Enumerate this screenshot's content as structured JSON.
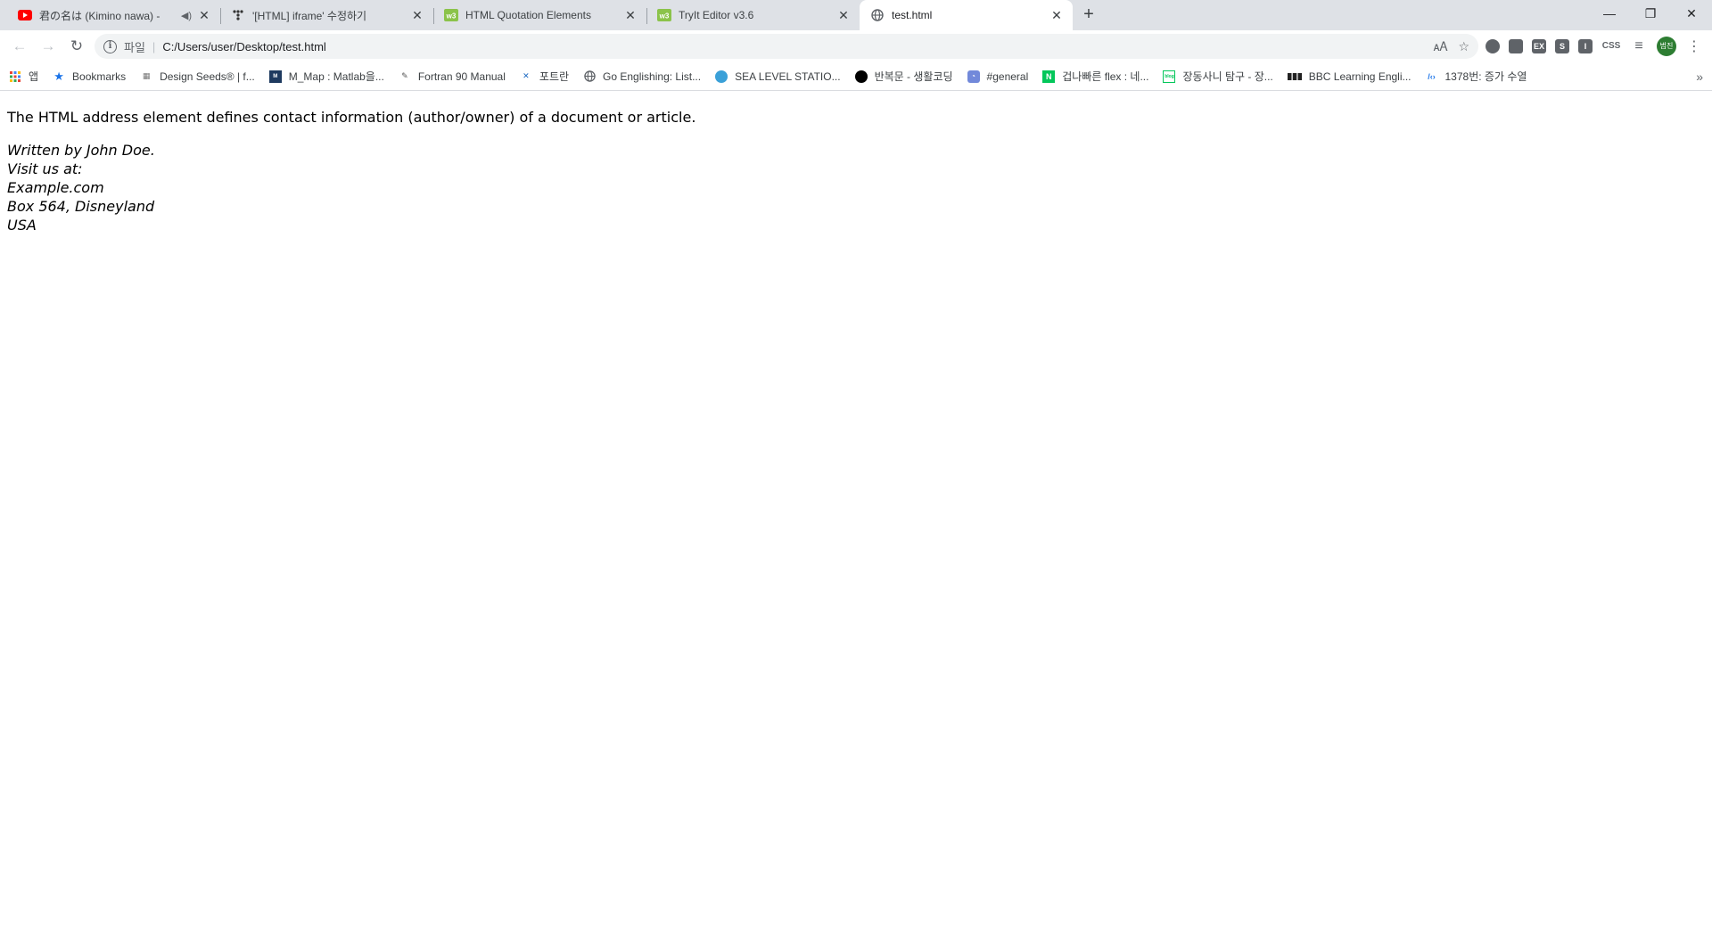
{
  "tabs": [
    {
      "title": "君の名は (Kimino nawa) - ",
      "favicon": "youtube-icon",
      "audio": true,
      "active": false
    },
    {
      "title": "'[HTML] iframe' 수정하기",
      "favicon": "velog-icon",
      "audio": false,
      "active": false
    },
    {
      "title": "HTML Quotation Elements",
      "favicon": "w3schools-icon",
      "audio": false,
      "active": false
    },
    {
      "title": "TryIt Editor v3.6",
      "favicon": "w3schools-icon",
      "audio": false,
      "active": false
    },
    {
      "title": "test.html",
      "favicon": "globe-icon",
      "audio": false,
      "active": true
    }
  ],
  "address_bar": {
    "scheme_label": "파일",
    "url": "C:/Users/user/Desktop/test.html"
  },
  "extensions": {
    "ext3": "EX",
    "ext4": "S",
    "ext5": "I",
    "ext6": "CSS"
  },
  "profile": {
    "initials": "범진"
  },
  "bookmarks": [
    {
      "label": "앱",
      "icon": "apps-grid-icon"
    },
    {
      "label": "Bookmarks",
      "icon": "star-icon"
    },
    {
      "label": "Design Seeds® | f...",
      "icon": "design-seeds-icon"
    },
    {
      "label": "M_Map : Matlab을...",
      "icon": "mmap-icon"
    },
    {
      "label": "Fortran 90 Manual",
      "icon": "fortran-icon"
    },
    {
      "label": "포트란",
      "icon": "dots-icon"
    },
    {
      "label": "Go Englishing: List...",
      "icon": "globe-icon"
    },
    {
      "label": "SEA LEVEL STATIO...",
      "icon": "sea-level-icon"
    },
    {
      "label": "반복문 - 생활코딩",
      "icon": "black-circle-icon"
    },
    {
      "label": "#general",
      "icon": "discord-icon"
    },
    {
      "label": "겁나빠른 flex : 네...",
      "icon": "naver-icon"
    },
    {
      "label": "장동사니 탐구 - 장...",
      "icon": "blog-icon"
    },
    {
      "label": "BBC Learning Engli...",
      "icon": "bbc-icon"
    },
    {
      "label": "1378번: 증가 수열",
      "icon": "code-icon"
    }
  ],
  "content": {
    "intro": "The HTML address element defines contact information (author/owner) of a document or article.",
    "address_lines": [
      "Written by John Doe.",
      "Visit us at:",
      "Example.com",
      "Box 564, Disneyland",
      "USA"
    ]
  },
  "colors": {
    "tabstrip": "#dee1e6",
    "youtube_red": "#ff0000",
    "w3_green": "#8bc34a",
    "avatar_green": "#2d7d32"
  }
}
